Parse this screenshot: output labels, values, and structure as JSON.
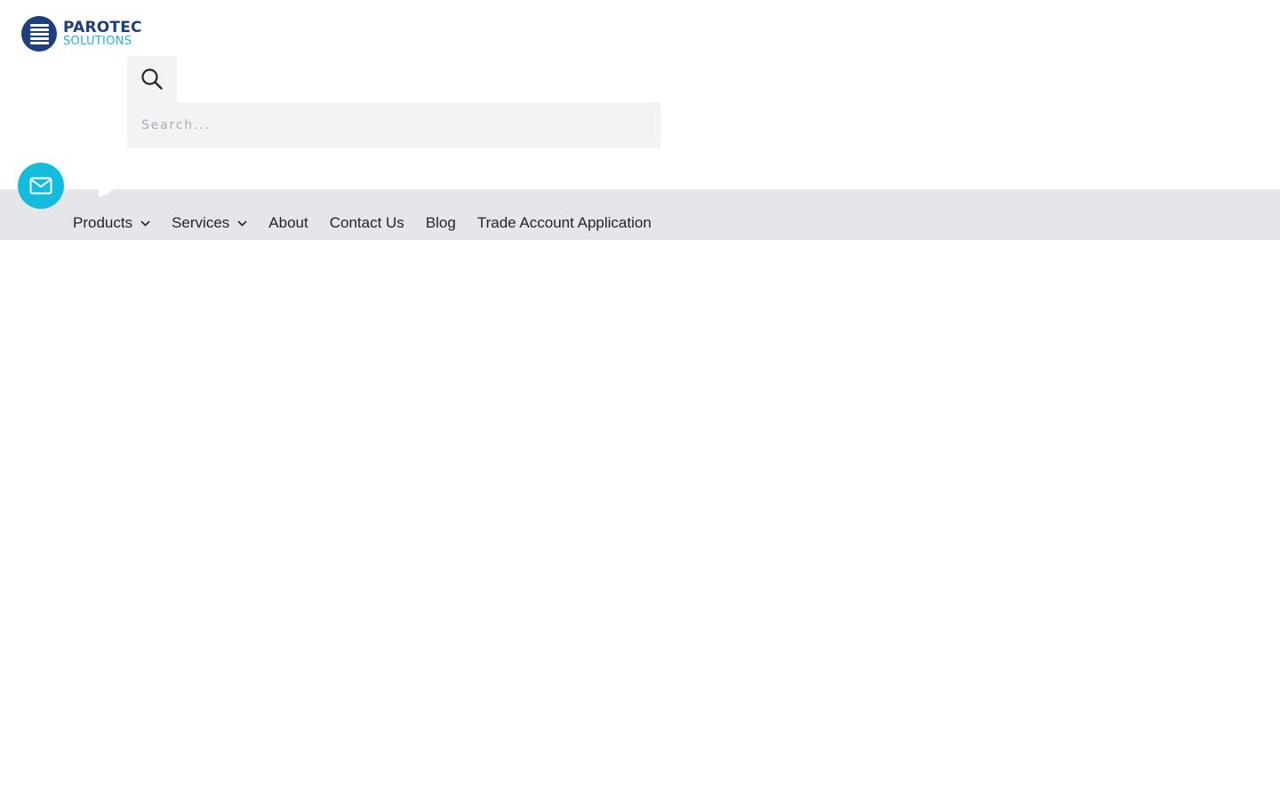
{
  "brand": {
    "name_line1": "PAROTEC",
    "name_line2": "SOLUTIONS",
    "colors": {
      "primary": "#1e3f7c",
      "accent": "#1fb4d8"
    }
  },
  "search": {
    "toggle_icon": "search-icon",
    "placeholder": "Search...",
    "value": ""
  },
  "floating": {
    "mail_icon": "mail-icon",
    "mail_color": "#13bcdd"
  },
  "nav": {
    "background": "#e5e6e9",
    "items": [
      {
        "label": "Products",
        "has_dropdown": true
      },
      {
        "label": "Services",
        "has_dropdown": true
      },
      {
        "label": "About",
        "has_dropdown": false
      },
      {
        "label": "Contact Us",
        "has_dropdown": false
      },
      {
        "label": "Blog",
        "has_dropdown": false
      },
      {
        "label": "Trade Account Application",
        "has_dropdown": false
      }
    ]
  }
}
